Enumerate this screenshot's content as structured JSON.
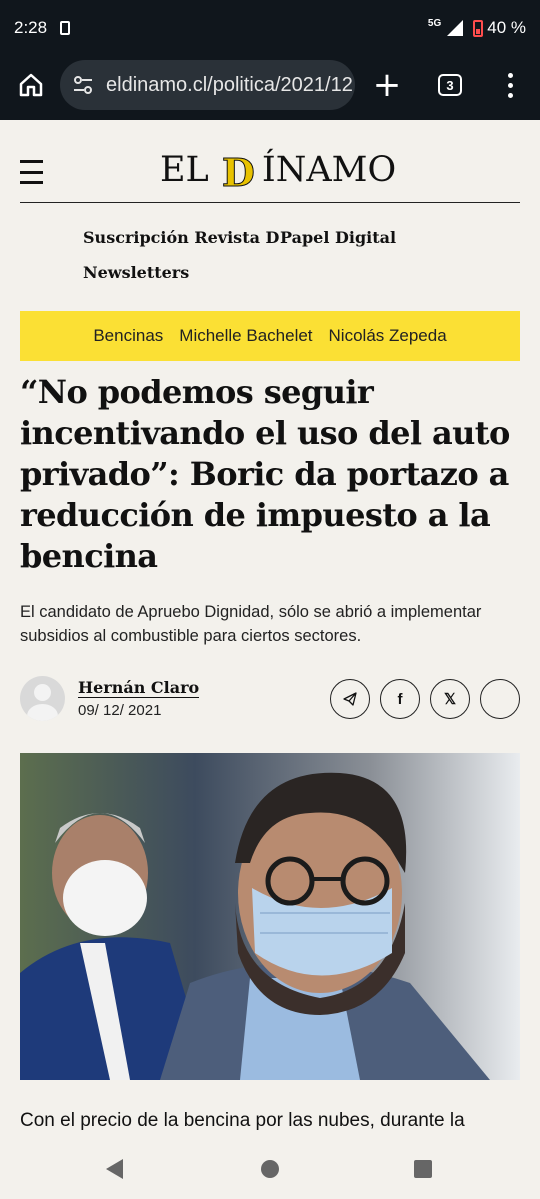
{
  "status_bar": {
    "time": "2:28",
    "network": "5G",
    "battery": "40 %"
  },
  "browser": {
    "url": "eldinamo.cl/politica/2021/12",
    "tab_count": "3"
  },
  "site": {
    "logo_prefix": "EL ",
    "logo_d": "D",
    "logo_suffix": "ÍNAMO",
    "nav_links": [
      "Suscripción Revista D",
      "Papel Digital",
      "Newsletters"
    ],
    "tags": [
      "Bencinas",
      "Michelle Bachelet",
      "Nicolás Zepeda"
    ],
    "brand_yellow": "#fbe034"
  },
  "article": {
    "headline": "“No podemos seguir incentivando el uso del auto privado”: Boric da portazo a reducción de impuesto a la bencina",
    "subtitle": "El candidato de Apruebo Dignidad, sólo se abrió a implementar subsidios al combustible para ciertos sectores.",
    "author": "Hernán Claro",
    "date": "09/ 12/ 2021",
    "share_icons": [
      "telegram-icon",
      "facebook-icon",
      "x-icon",
      "more-icon"
    ],
    "body_first_line": "Con el precio de la bencina por las nubes, durante la"
  }
}
